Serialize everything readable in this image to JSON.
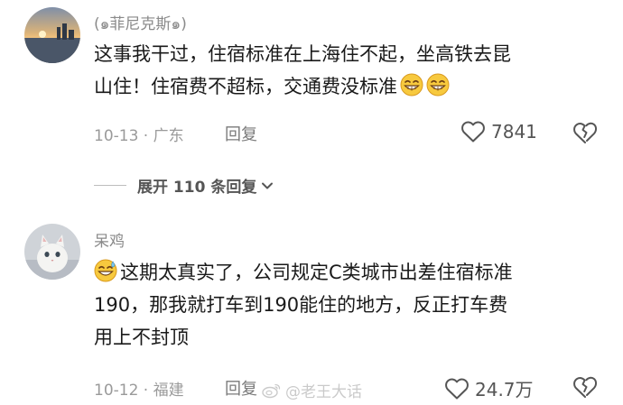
{
  "comments": [
    {
      "username": "(๑菲尼克斯๑)",
      "lines": [
        "这事我干过，住宿标准在上海住不起，坐高铁去昆",
        "山住！住宿费不超标，交通费没标准"
      ],
      "emojis_after_text": [
        "grin-emoji",
        "grin-emoji"
      ],
      "date_location": "10-13 · 广东",
      "reply_label": "回复",
      "like_count": "7841"
    },
    {
      "username": "呆鸡",
      "leading_emoji": "sweat-grin-emoji",
      "lines": [
        "这期太真实了，公司规定C类城市出差住宿标准",
        "190，那我就打车到190能住的地方，反正打车费",
        "用上不封顶"
      ],
      "date_location": "10-12 · 福建",
      "reply_label": "回复",
      "like_count": "24.7万"
    }
  ],
  "expand_replies": {
    "label": "展开 110 条回复"
  },
  "watermark": {
    "text": "@老王大话"
  },
  "colors": {
    "meta": "#9a9a9a",
    "text": "#1a1a1a",
    "icon": "#555555"
  }
}
